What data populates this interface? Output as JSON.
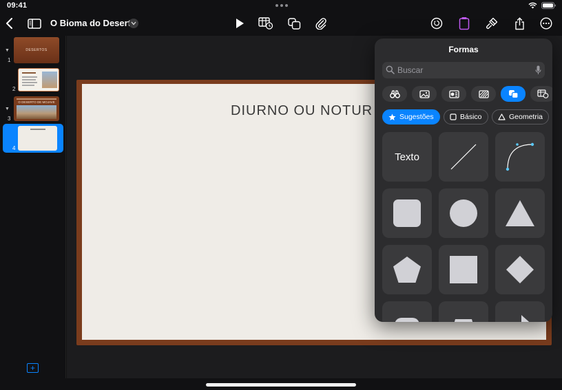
{
  "status": {
    "time": "09:41",
    "battery": ""
  },
  "toolbar": {
    "title": "O Bioma do Deserto",
    "buttons": [
      "back",
      "sidebar",
      "play",
      "table",
      "shapes",
      "media",
      "undo",
      "insert",
      "format",
      "share",
      "more"
    ]
  },
  "navigator": {
    "slides": [
      {
        "number": "1",
        "label": "DESERTOS"
      },
      {
        "number": "2",
        "label": ""
      },
      {
        "number": "3",
        "label": "O DESERTO DE MOJAVE"
      },
      {
        "number": "4",
        "label": ""
      }
    ],
    "selected": "4"
  },
  "slide": {
    "title": "DIURNO OU NOTUR"
  },
  "popover": {
    "title": "Formas",
    "search_placeholder": "Buscar",
    "chips": [
      "Sugestões",
      "Básico",
      "Geometria"
    ],
    "text_tile": "Texto"
  },
  "colors": {
    "accent": "#0a84ff",
    "slide_frame": "#7a3c1d",
    "panel": "#2c2c2e"
  }
}
